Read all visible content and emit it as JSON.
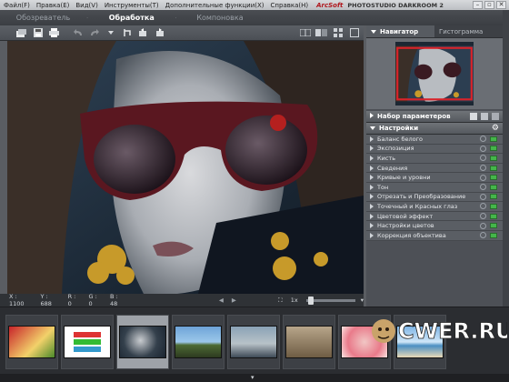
{
  "menu": {
    "items": [
      "Файл(F)",
      "Правка(E)",
      "Вид(V)",
      "Инструменты(T)",
      "Дополнительные функции(X)",
      "Справка(H)"
    ],
    "brand": "ArcSoft",
    "product": "PHOTOSTUDIO DARKROOM 2"
  },
  "modes": {
    "tabs": [
      "Обозреватель",
      "Обработка",
      "Компоновка"
    ],
    "active": "Обработка"
  },
  "status": {
    "x": "X : 1100",
    "y": "Y : 688",
    "r": "R : 0",
    "g": "G : 0",
    "b": "B : 48",
    "zoom": "1x"
  },
  "panel": {
    "navigator": "Навигатор",
    "histogram": "Гистограмма",
    "presets": "Набор параметеров",
    "settings": "Настройки",
    "settings_items": [
      "Баланс белого",
      "Экспозиция",
      "Кисть",
      "Сведения",
      "Кривые и уровни",
      "Тон",
      "Отрезать и Преобразование",
      "Точечный и Красных глаз",
      "Цветовой эффект",
      "Настройки цветов",
      "Коррекция объектива"
    ]
  },
  "watermark": "CWER.RU",
  "colors": {
    "accent_toggle": "#44b54a",
    "brand_red": "#b0161c",
    "selected_thumb": "#9ea2a8"
  }
}
